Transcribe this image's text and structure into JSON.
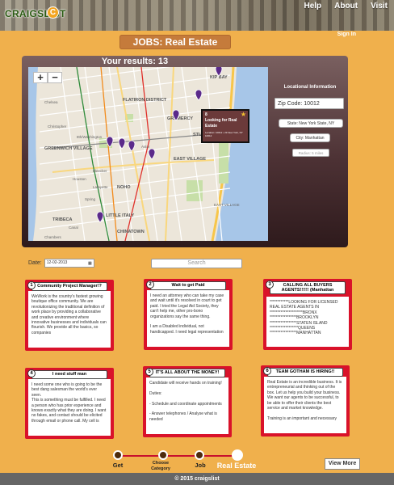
{
  "header": {
    "logo": "CRAIGSLIST",
    "logo_badge": "C",
    "nav": [
      "Help",
      "About",
      "Visit"
    ],
    "sign_in": "Sign In"
  },
  "page_title": "JOBS: Real Estate",
  "results": {
    "label": "Your results: 13"
  },
  "map": {
    "zoom_in": "+",
    "zoom_out": "−",
    "neighborhoods": [
      "FLATIRON DISTRICT",
      "GREENWICH VILLAGE",
      "EAST VILLAGE",
      "STUYVESANT TOWN",
      "LITTLE ITALY",
      "NOHO",
      "CHINATOWN",
      "TRIBECA",
      "KIP BAY",
      "GRAMERCY",
      "Chelsea",
      "Christopher",
      "Houston",
      "Bleecker",
      "Spring",
      "Canal",
      "Chambers",
      "8th/Washington",
      "Astor",
      "Lafayette",
      "EAST VILLAGE"
    ],
    "popup": {
      "number": "8",
      "title": "Looking for Real Estate",
      "meta": "Location: 10012 • 23 New York, NY 10012",
      "star": "★"
    }
  },
  "location_panel": {
    "title": "Locational Information",
    "zip": "Zip Code: 10012",
    "state": "State: New York State, NY",
    "city": "City: Manhattan",
    "radius": "Radius: 5 miles"
  },
  "filters": {
    "date_label": "Date:",
    "date_value": "12-02-2013",
    "search_placeholder": "Search"
  },
  "cards": [
    {
      "num": "1",
      "title": "Community Project Manager!?",
      "body": "WeWork is the country's fastest growing boutique office community. We are revolutionizing the traditional definition of work place by providing a collaborative and creative environment where innovative businesses and individuals can flourish. We provide all the basics, so companies"
    },
    {
      "num": "2",
      "title": "Wait to get Paid",
      "body": "I need an attorney who can take my case and wait until it's resolved in court to get paid. I tried the Legal Aid Society, they can't help me, other pro-bono organizations say the same thing.\n\nI am a Disabled individual, not handicapped. I need legal representation"
    },
    {
      "num": "3",
      "title": "CALLING ALL BUYERS AGENTS!!!!!! (Manhattan",
      "body": "************LOOKING FOR LICENSED REAL ESTATE AGENTS IN\n*********************BRONX\n*****************BROOKLYN\n*****************STATEN ISLAND\n******************QUEENS\n*****************MANHATTAN"
    },
    {
      "num": "4",
      "title": "I need stuff man",
      "body": "I need some one who is going to be the best dang salesman the world's ever seen.\nThis is something must be fulfilled. I need a person who has prior experience and knows exactly what they are doing. I want no fakes, and contact should be elicited through email or phone call. My cell is"
    },
    {
      "num": "5",
      "title": "IT'S ALL ABOUT THE MONEY!",
      "body": "Candidate will receive hands on training!\n\nDuties:\n\n- Schedule and coordinate appointments\n\n- Answer telephones / Analyse what is needed"
    },
    {
      "num": "6",
      "title": "TEAM GOTHAM IS HIRING!!",
      "body": "Real Estate is an incredible business. It is entrepreneurial and thinking out of the box. Let us help you build your business. We want our agents to be successful, to be able to offer their clients the best service and market knowledge.\n\nTraining is an important and necessary"
    }
  ],
  "progress": {
    "steps": [
      "Get",
      "Choose Category",
      "Job",
      "Real Estate"
    ],
    "active_index": 3
  },
  "view_more": "View More",
  "footer": "© 2015 craigslist"
}
